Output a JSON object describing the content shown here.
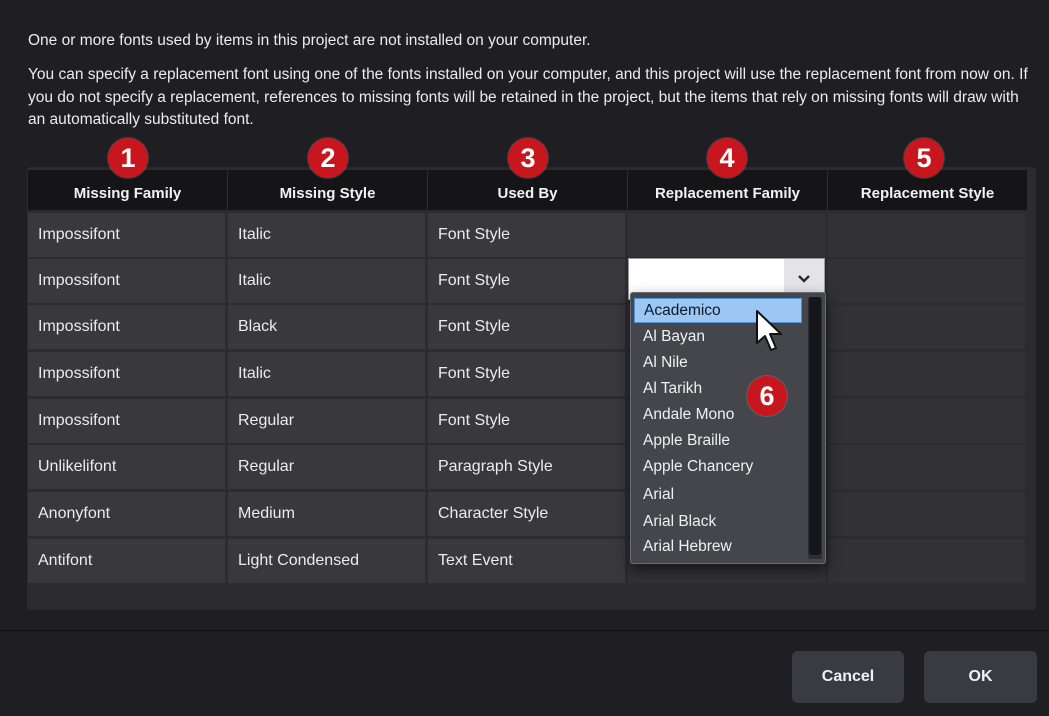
{
  "message": {
    "line1": "One or more fonts used by items in this project are not installed on your computer.",
    "line2": "You can specify a replacement font using one of the fonts installed on your computer, and this project will use the replacement font from now on. If you do not specify a replacement, references to missing fonts will be retained in the project, but the items that rely on missing fonts will draw with an automatically substituted font."
  },
  "table": {
    "headers": [
      "Missing Family",
      "Missing Style",
      "Used By",
      "Replacement Family",
      "Replacement Style"
    ],
    "rows": [
      [
        "Impossifont",
        "Italic",
        "Font Style",
        "",
        ""
      ],
      [
        "Impossifont",
        "Italic",
        "Font Style",
        "",
        ""
      ],
      [
        "Impossifont",
        "Black",
        "Font Style",
        "",
        ""
      ],
      [
        "Impossifont",
        "Italic",
        "Font Style",
        "",
        ""
      ],
      [
        "Impossifont",
        "Regular",
        "Font Style",
        "",
        ""
      ],
      [
        "Unlikelifont",
        "Regular",
        "Paragraph Style",
        "",
        ""
      ],
      [
        "Anonyfont",
        "Medium",
        "Character Style",
        "",
        ""
      ],
      [
        "Antifont",
        "Light Condensed",
        "Text Event",
        "",
        ""
      ]
    ]
  },
  "callouts": [
    "1",
    "2",
    "3",
    "4",
    "5",
    "6"
  ],
  "replacement_dropdown": {
    "value": "",
    "options": [
      "Academico",
      "Al Bayan",
      "Al Nile",
      "Al Tarikh",
      "Andale Mono",
      "Apple Braille",
      "Apple Chancery",
      "Arial",
      "Arial Black",
      "Arial Hebrew"
    ],
    "highlighted": "Academico"
  },
  "buttons": {
    "cancel": "Cancel",
    "ok": "OK"
  },
  "colors": {
    "callout": "#c8161e",
    "highlight": "#9dc7f3"
  }
}
